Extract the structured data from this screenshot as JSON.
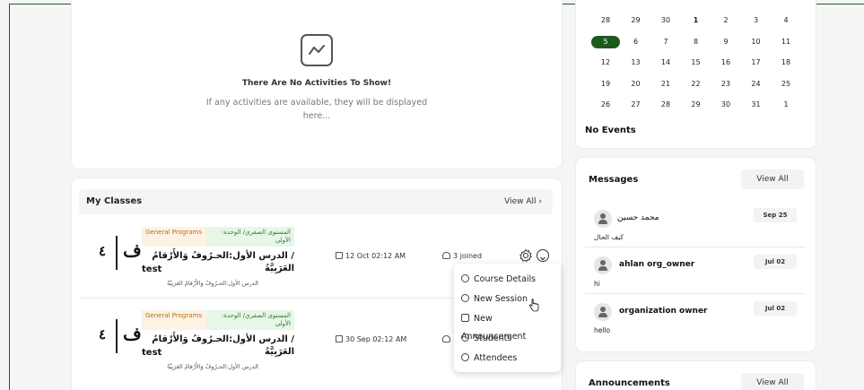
{
  "activities": {
    "empty_title": "There Are No Activities To Show!",
    "empty_subtitle": "If any activities are available, they will be displayed here...",
    "empty_icon": "activity-chart-icon"
  },
  "classes": {
    "title": "My Classes",
    "view_all": "View All",
    "rows": [
      {
        "logo_number": "٤",
        "logo_letter": "ف",
        "tag_category": "General Programs",
        "tag_unit": "المستوى الصفري/ الوحدة: الأولى",
        "title_ar": "/ الدرس الأول:الحـرُوفُ وَالأَرْقامُ العَرَبِيَّةُ",
        "title_en": "test",
        "subtitle": "الدرس الأول:الحـرُوفُ وَالأَرْقامُ العَرَبِيَّةُ",
        "date": "12 Oct 02:12 AM",
        "joined": "3 joined"
      },
      {
        "logo_number": "٤",
        "logo_letter": "ف",
        "tag_category": "General Programs",
        "tag_unit": "المستوى الصفري/ الوحدة: الأولى",
        "title_ar": "/ الدرس الأول:الحـرُوفُ وَالأَرْقامُ العَرَبِيَّةُ",
        "title_en": "test",
        "subtitle": "الدرس الأول:الحـرُوفُ وَالأَرْقامُ العَرَبِيَّةُ",
        "date": "30 Sep 02:12 AM",
        "joined": ""
      }
    ],
    "menu": [
      "Course Details",
      "New Session",
      "New Announcement",
      "Students",
      "Attendees"
    ]
  },
  "calendar": {
    "weeks": [
      [
        "28",
        "29",
        "30",
        "1",
        "2",
        "3",
        "4"
      ],
      [
        "5",
        "6",
        "7",
        "8",
        "9",
        "10",
        "11"
      ],
      [
        "12",
        "13",
        "14",
        "15",
        "16",
        "17",
        "18"
      ],
      [
        "19",
        "20",
        "21",
        "22",
        "23",
        "24",
        "25"
      ],
      [
        "26",
        "27",
        "28",
        "29",
        "30",
        "31",
        "1"
      ]
    ],
    "selected_day": "5",
    "marked_day": "1",
    "no_events": "No Events",
    "accent_color": "#1c5a1b"
  },
  "messages": {
    "title": "Messages",
    "view_all": "View All",
    "items": [
      {
        "name": "محمد حسين",
        "date": "Sep 25",
        "text": "كيف الحال"
      },
      {
        "name": "ahlan org_owner",
        "date": "Jul 02",
        "text": "hi"
      },
      {
        "name": "organization owner",
        "date": "Jul 02",
        "text": "hello"
      }
    ]
  },
  "announcements": {
    "title": "Announcements",
    "view_all": "View All"
  }
}
